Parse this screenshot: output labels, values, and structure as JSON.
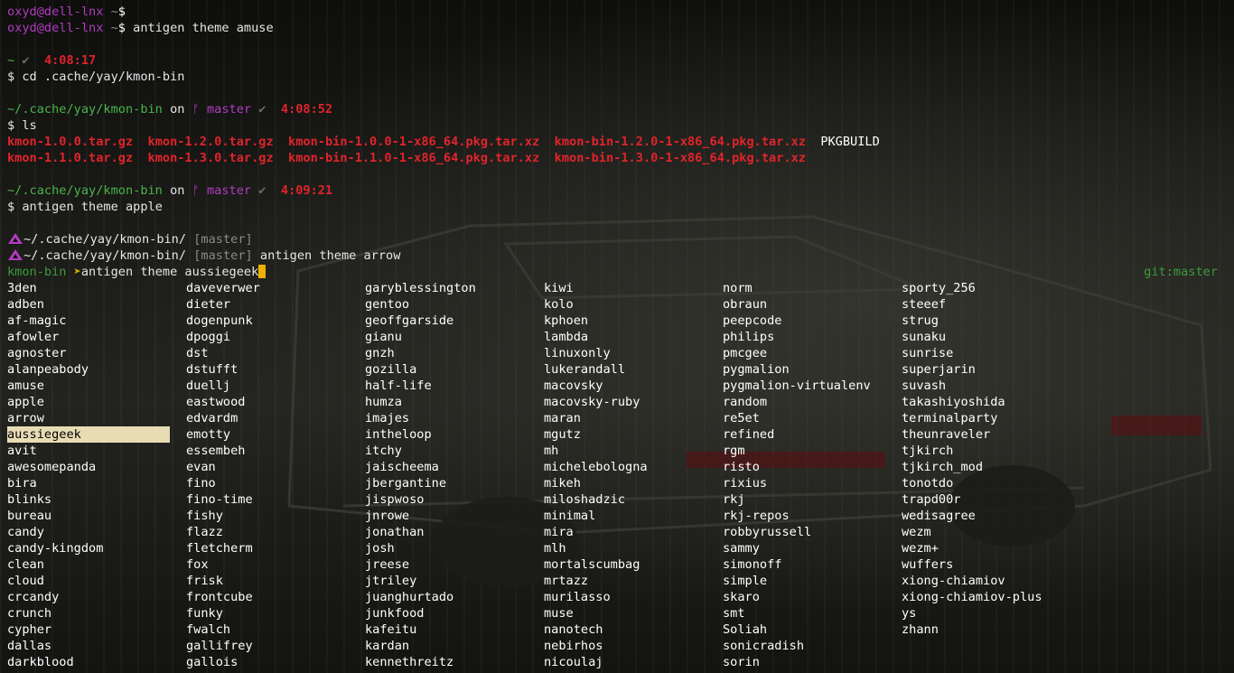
{
  "prompt": {
    "user_host": "oxyd@dell-lnx",
    "tilde": "~",
    "dollar": "$",
    "check": "✔",
    "branch_icon": "ᚠ"
  },
  "lines": {
    "l1_cmd": "",
    "l2_cmd": "antigen theme amuse",
    "l4_dir": "~",
    "l4_time": "4:08:17",
    "l5_cmd": "cd .cache/yay/kmon-bin",
    "l7_dir": "~/.cache/yay/kmon-bin",
    "l7_on": "on",
    "l7_branch": "master",
    "l7_time": "4:08:52",
    "l8_cmd": "ls",
    "ls_row1": [
      "kmon-1.0.0.tar.gz",
      "kmon-1.2.0.tar.gz",
      "kmon-bin-1.0.0-1-x86_64.pkg.tar.xz",
      "kmon-bin-1.2.0-1-x86_64.pkg.tar.xz"
    ],
    "ls_row1_plain": "PKGBUILD",
    "ls_row2": [
      "kmon-1.1.0.tar.gz",
      "kmon-1.3.0.tar.gz",
      "kmon-bin-1.1.0-1-x86_64.pkg.tar.xz",
      "kmon-bin-1.3.0-1-x86_64.pkg.tar.xz"
    ],
    "l12_dir": "~/.cache/yay/kmon-bin",
    "l12_on": "on",
    "l12_branch": "master",
    "l12_time": "4:09:21",
    "l13_cmd": "antigen theme apple",
    "apple_dir": "~/.cache/yay/kmon-bin/",
    "apple_branch": "[master]",
    "l16_cmd": "antigen theme arrow",
    "arrow_dir": "kmon-bin",
    "arrow_sym": "➤",
    "l17_cmd": "antigen theme aussiegeek",
    "git_status": "git:master"
  },
  "themes": [
    "3den",
    "adben",
    "af-magic",
    "afowler",
    "agnoster",
    "alanpeabody",
    "amuse",
    "apple",
    "arrow",
    "aussiegeek",
    "avit",
    "awesomepanda",
    "bira",
    "blinks",
    "bureau",
    "candy",
    "candy-kingdom",
    "clean",
    "cloud",
    "crcandy",
    "crunch",
    "cypher",
    "dallas",
    "darkblood",
    "daveverwer",
    "dieter",
    "dogenpunk",
    "dpoggi",
    "dst",
    "dstufft",
    "duellj",
    "eastwood",
    "edvardm",
    "emotty",
    "essembeh",
    "evan",
    "fino",
    "fino-time",
    "fishy",
    "flazz",
    "fletcherm",
    "fox",
    "frisk",
    "frontcube",
    "funky",
    "fwalch",
    "gallifrey",
    "gallois",
    "garyblessington",
    "gentoo",
    "geoffgarside",
    "gianu",
    "gnzh",
    "gozilla",
    "half-life",
    "humza",
    "imajes",
    "intheloop",
    "itchy",
    "jaischeema",
    "jbergantine",
    "jispwoso",
    "jnrowe",
    "jonathan",
    "josh",
    "jreese",
    "jtriley",
    "juanghurtado",
    "junkfood",
    "kafeitu",
    "kardan",
    "kennethreitz",
    "kiwi",
    "kolo",
    "kphoen",
    "lambda",
    "linuxonly",
    "lukerandall",
    "macovsky",
    "macovsky-ruby",
    "maran",
    "mgutz",
    "mh",
    "michelebologna",
    "mikeh",
    "miloshadzic",
    "minimal",
    "mira",
    "mlh",
    "mortalscumbag",
    "mrtazz",
    "murilasso",
    "muse",
    "nanotech",
    "nebirhos",
    "nicoulaj",
    "norm",
    "obraun",
    "peepcode",
    "philips",
    "pmcgee",
    "pygmalion",
    "pygmalion-virtualenv",
    "random",
    "re5et",
    "refined",
    "rgm",
    "risto",
    "rixius",
    "rkj",
    "rkj-repos",
    "robbyrussell",
    "sammy",
    "simonoff",
    "simple",
    "skaro",
    "smt",
    "Soliah",
    "sonicradish",
    "sorin",
    "sporty_256",
    "steeef",
    "strug",
    "sunaku",
    "sunrise",
    "superjarin",
    "suvash",
    "takashiyoshida",
    "terminalparty",
    "theunraveler",
    "tjkirch",
    "tjkirch_mod",
    "tonotdo",
    "trapd00r",
    "wedisagree",
    "wezm",
    "wezm+",
    "wuffers",
    "xiong-chiamiov",
    "xiong-chiamiov-plus",
    "ys",
    "zhann"
  ],
  "selected_theme": "aussiegeek",
  "colors": {
    "green": "#4ab54a",
    "red": "#e0242b",
    "purple": "#b03cc0",
    "cursor": "#f0b000",
    "selection": "#e8dcb5"
  }
}
